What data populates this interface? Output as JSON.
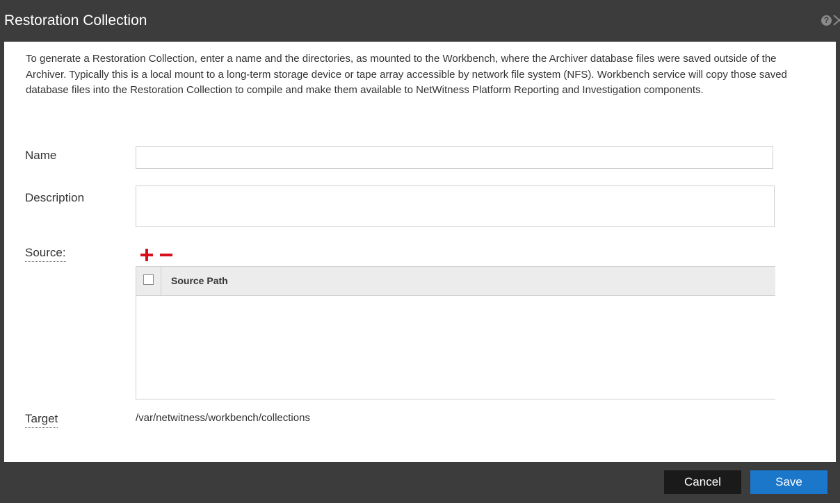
{
  "dialog": {
    "title": "Restoration Collection",
    "help_glyph": "?",
    "intro": "To generate a Restoration Collection, enter a name and the directories, as mounted to the Workbench, where the Archiver database files were saved outside of the Archiver. Typically this is a local mount to a long-term storage device or tape array accessible by network file system (NFS). Workbench service will copy those saved database files into the Restoration Collection to compile and make them available to NetWitness Platform Reporting and Investigation components."
  },
  "form": {
    "name_label": "Name",
    "name_value": "",
    "description_label": "Description",
    "description_value": "",
    "source_label": "Source:",
    "target_label": "Target",
    "target_value": "/var/netwitness/workbench/collections"
  },
  "source_grid": {
    "columns": [
      "Source Path"
    ],
    "rows": []
  },
  "footer": {
    "cancel_label": "Cancel",
    "save_label": "Save"
  },
  "icons": {
    "help": "help-icon",
    "close": "close-icon",
    "add": "plus-icon",
    "remove": "minus-icon"
  },
  "colors": {
    "titlebar": "#3c3c3c",
    "accent_red": "#d80f1a",
    "save_button": "#1a77c9",
    "cancel_button": "#1a1a1a"
  }
}
